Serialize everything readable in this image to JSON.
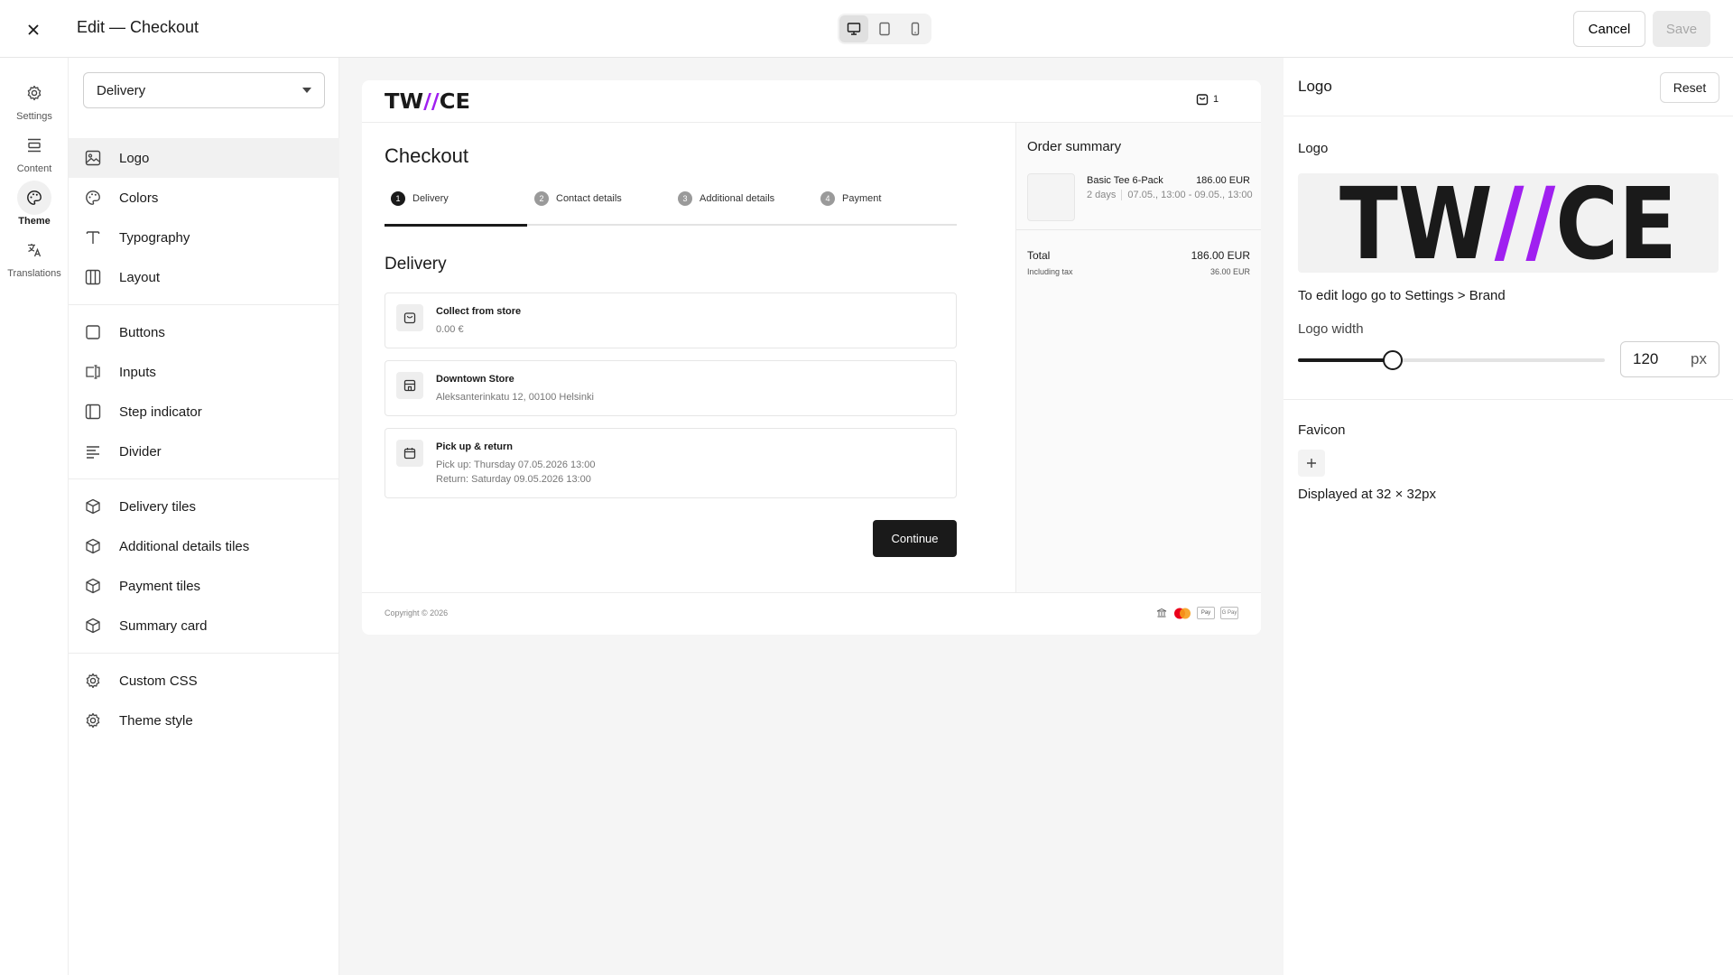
{
  "header": {
    "title": "Edit — Checkout",
    "cancel_label": "Cancel",
    "save_label": "Save",
    "device_modes": [
      "desktop",
      "tablet",
      "mobile"
    ],
    "active_device": "desktop"
  },
  "rail": {
    "items": [
      {
        "label": "Settings",
        "icon": "gear-icon"
      },
      {
        "label": "Content",
        "icon": "content-icon"
      },
      {
        "label": "Theme",
        "icon": "palette-icon",
        "active": true
      },
      {
        "label": "Translations",
        "icon": "translate-icon"
      }
    ]
  },
  "nav": {
    "select_value": "Delivery",
    "items": [
      {
        "label": "Logo",
        "icon": "image-icon",
        "active": true
      },
      {
        "label": "Colors",
        "icon": "palette-icon"
      },
      {
        "label": "Typography",
        "icon": "typography-icon"
      },
      {
        "label": "Layout",
        "icon": "columns-icon"
      },
      {
        "label": "Buttons",
        "icon": "square-icon"
      },
      {
        "label": "Inputs",
        "icon": "input-icon"
      },
      {
        "label": "Step indicator",
        "icon": "panel-icon"
      },
      {
        "label": "Divider",
        "icon": "lines-icon"
      },
      {
        "label": "Delivery tiles",
        "icon": "cube-icon"
      },
      {
        "label": "Additional details tiles",
        "icon": "cube-icon"
      },
      {
        "label": "Payment tiles",
        "icon": "cube-icon"
      },
      {
        "label": "Summary card",
        "icon": "cube-icon"
      },
      {
        "label": "Custom CSS",
        "icon": "gear-icon"
      },
      {
        "label": "Theme style",
        "icon": "gear-icon"
      }
    ]
  },
  "preview": {
    "logo_text": "TW//CE",
    "cart_count": "1",
    "title": "Checkout",
    "steps": [
      {
        "num": "1",
        "label": "Delivery",
        "active": true
      },
      {
        "num": "2",
        "label": "Contact details"
      },
      {
        "num": "3",
        "label": "Additional details"
      },
      {
        "num": "4",
        "label": "Payment"
      }
    ],
    "section_title": "Delivery",
    "tiles": [
      {
        "title": "Collect from store",
        "lines": [
          "0.00 €"
        ],
        "icon": "bag-icon"
      },
      {
        "title": "Downtown Store",
        "lines": [
          "Aleksanterinkatu 12, 00100 Helsinki"
        ],
        "icon": "store-icon"
      },
      {
        "title": "Pick up & return",
        "lines": [
          "Pick up: Thursday 07.05.2026 13:00",
          "Return: Saturday 09.05.2026 13:00"
        ],
        "icon": "calendar-icon"
      }
    ],
    "continue_label": "Continue",
    "order_summary": {
      "title": "Order summary",
      "item_name": "Basic Tee 6-Pack",
      "item_price": "186.00 EUR",
      "item_duration": "2 days",
      "item_dates": "07.05., 13:00 - 09.05., 13:00",
      "total_label": "Total",
      "total_value": "186.00 EUR",
      "tax_label": "Including tax",
      "tax_value": "36.00 EUR"
    },
    "copyright": "Copyright © 2026",
    "payment_icons": [
      "bank-icon",
      "mastercard-icon",
      "applepay-icon",
      "googlepay-icon"
    ],
    "applepay_text": "Pay",
    "googlepay_text": "G Pay"
  },
  "props": {
    "title": "Logo",
    "reset_label": "Reset",
    "logo_section_label": "Logo",
    "logo_hint_prefix": "To edit logo go to ",
    "logo_hint_link": "Settings > Brand",
    "logo_width_label": "Logo width",
    "logo_width_value": "120",
    "logo_width_unit": "px",
    "logo_width_slider_fraction": 0.31,
    "favicon_label": "Favicon",
    "favicon_hint": "Displayed at 32 × 32px"
  },
  "colors": {
    "brand_purple": "#a020f0",
    "primary": "#1a1a1a",
    "mastercard_red": "#eb001b",
    "mastercard_orange": "#f79e1b"
  }
}
